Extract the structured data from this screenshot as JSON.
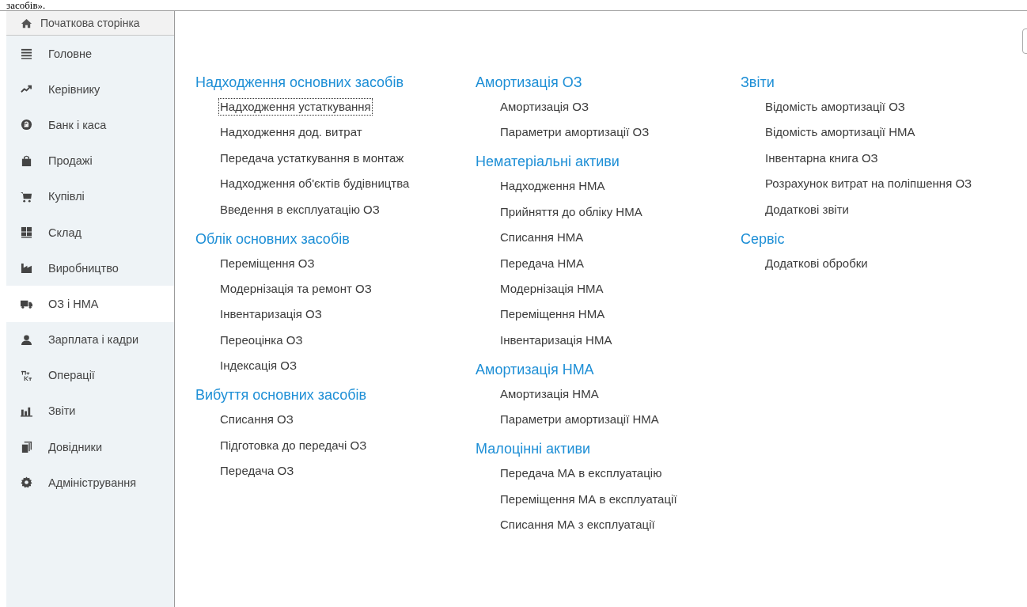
{
  "document_fragment": "засобів».",
  "sidebar": {
    "home": {
      "label": "Початкова сторінка"
    },
    "items": [
      {
        "label": "Головне",
        "kind": "menu",
        "selected": false
      },
      {
        "label": "Керівнику",
        "kind": "trend",
        "selected": false
      },
      {
        "label": "Банк і каса",
        "kind": "coin",
        "selected": false
      },
      {
        "label": "Продажі",
        "kind": "bag",
        "selected": false
      },
      {
        "label": "Купівлі",
        "kind": "cart",
        "selected": false
      },
      {
        "label": "Склад",
        "kind": "grid",
        "selected": false
      },
      {
        "label": "Виробництво",
        "kind": "factory",
        "selected": false
      },
      {
        "label": "ОЗ і НМА",
        "kind": "truck",
        "selected": true
      },
      {
        "label": "Зарплата і кадри",
        "kind": "person",
        "selected": false
      },
      {
        "label": "Операції",
        "kind": "dtkt",
        "selected": false
      },
      {
        "label": "Звіти",
        "kind": "bars",
        "selected": false
      },
      {
        "label": "Довідники",
        "kind": "books",
        "selected": false
      },
      {
        "label": "Адміністрування",
        "kind": "gear",
        "selected": false
      }
    ]
  },
  "columns": [
    [
      {
        "title": "Надходження основних засобів",
        "items": [
          {
            "label": "Надходження устаткування",
            "focused": true
          },
          {
            "label": "Надходження дод. витрат",
            "focused": false
          },
          {
            "label": "Передача устаткування в монтаж",
            "focused": false
          },
          {
            "label": "Надходження об'єктів будівництва",
            "focused": false
          },
          {
            "label": "Введення в експлуатацію ОЗ",
            "focused": false
          }
        ]
      },
      {
        "title": "Облік основних засобів",
        "items": [
          {
            "label": "Переміщення ОЗ",
            "focused": false
          },
          {
            "label": "Модернізація та ремонт ОЗ",
            "focused": false
          },
          {
            "label": "Інвентаризація ОЗ",
            "focused": false
          },
          {
            "label": "Переоцінка ОЗ",
            "focused": false
          },
          {
            "label": "Індексація ОЗ",
            "focused": false
          }
        ]
      },
      {
        "title": "Вибуття основних засобів",
        "items": [
          {
            "label": "Списання ОЗ",
            "focused": false
          },
          {
            "label": "Підготовка до передачі ОЗ",
            "focused": false
          },
          {
            "label": "Передача ОЗ",
            "focused": false
          }
        ]
      }
    ],
    [
      {
        "title": "Амортизація ОЗ",
        "items": [
          {
            "label": "Амортизація ОЗ",
            "focused": false
          },
          {
            "label": "Параметри амортизації ОЗ",
            "focused": false
          }
        ]
      },
      {
        "title": "Нематеріальні активи",
        "items": [
          {
            "label": "Надходження НМА",
            "focused": false
          },
          {
            "label": "Прийняття до обліку НМА",
            "focused": false
          },
          {
            "label": "Списання НМА",
            "focused": false
          },
          {
            "label": "Передача НМА",
            "focused": false
          },
          {
            "label": "Модернізація НМА",
            "focused": false
          },
          {
            "label": "Переміщення НМА",
            "focused": false
          },
          {
            "label": "Інвентаризація НМА",
            "focused": false
          }
        ]
      },
      {
        "title": "Амортизація НМА",
        "items": [
          {
            "label": "Амортизація НМА",
            "focused": false
          },
          {
            "label": "Параметри амортизації НМА",
            "focused": false
          }
        ]
      },
      {
        "title": "Малоцінні активи",
        "items": [
          {
            "label": "Передача МА в експлуатацію",
            "focused": false
          },
          {
            "label": "Переміщення МА в експлуатації",
            "focused": false
          },
          {
            "label": "Списання МА з експлуатації",
            "focused": false
          }
        ]
      }
    ],
    [
      {
        "title": "Звіти",
        "items": [
          {
            "label": "Відомість амортизації ОЗ",
            "focused": false
          },
          {
            "label": "Відомість амортизації НМА",
            "focused": false
          },
          {
            "label": "Інвентарна книга ОЗ",
            "focused": false
          },
          {
            "label": "Розрахунок витрат на поліпшення ОЗ",
            "focused": false
          },
          {
            "label": "Додаткові звіти",
            "focused": false
          }
        ]
      },
      {
        "title": "Сервіс",
        "items": [
          {
            "label": "Додаткові обробки",
            "focused": false
          }
        ]
      }
    ]
  ]
}
